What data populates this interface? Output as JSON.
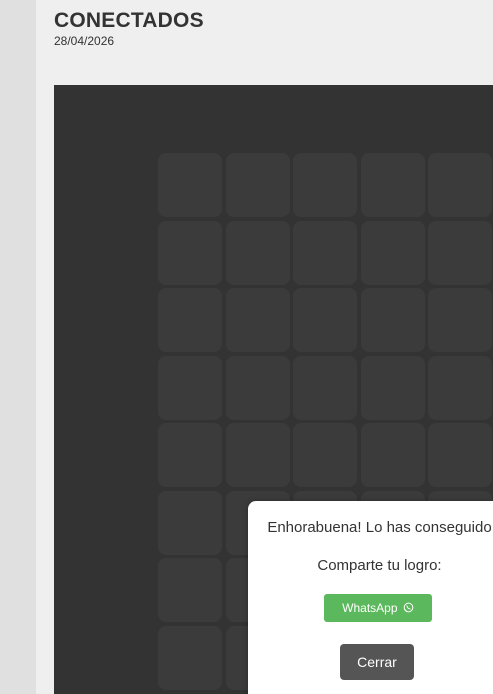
{
  "header": {
    "title": "CONECTADOS",
    "date": "28/04/2026"
  },
  "board": {
    "rows": 8,
    "cols": 5,
    "cell_color": "#3b3b3b",
    "background_color": "#333333"
  },
  "modal": {
    "message": "Enhorabuena! Lo has conseguido",
    "share_prompt": "Comparte tu logro:",
    "whatsapp_label": "WhatsApp",
    "whatsapp_icon": "whatsapp-icon",
    "whatsapp_color": "#5cb85c",
    "close_label": "Cerrar",
    "close_color": "#555555"
  }
}
